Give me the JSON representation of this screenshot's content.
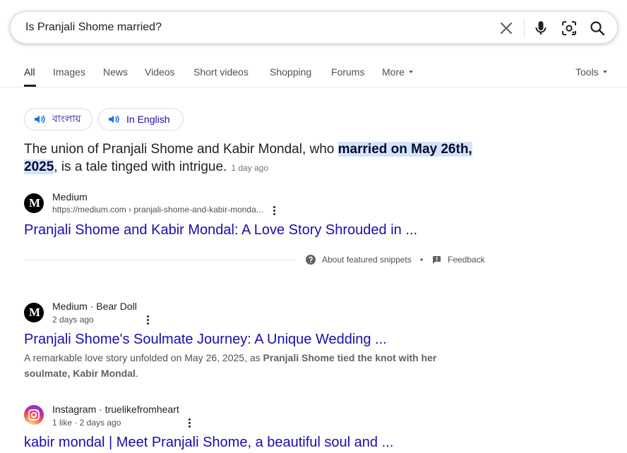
{
  "search": {
    "query": "Is Pranjali Shome married?"
  },
  "tabs": [
    {
      "label": "All"
    },
    {
      "label": "Images"
    },
    {
      "label": "News"
    },
    {
      "label": "Videos"
    },
    {
      "label": "Short videos"
    },
    {
      "label": "Shopping"
    },
    {
      "label": "Forums"
    },
    {
      "label": "More"
    }
  ],
  "tools_label": "Tools",
  "language_pills": {
    "bengali": "বাংলায়",
    "english": "In English"
  },
  "snippet": {
    "text_before": "The union of Pranjali Shome and Kabir Mondal, who ",
    "highlight": "married on May 26th, 2025",
    "text_after": ", is a tale tinged with intrigue.",
    "date": "1 day ago"
  },
  "featured_source": {
    "logo_text": "M",
    "name": "Medium",
    "url": "https://medium.com › pranjali-shome-and-kabir-monda...",
    "title": "Pranjali Shome and Kabir Mondal: A Love Story Shrouded in ..."
  },
  "about": {
    "about_label": "About featured snippets",
    "bullet": "•",
    "feedback_label": "Feedback"
  },
  "results": [
    {
      "logo_text": "M",
      "name": "Medium · Bear Doll",
      "sub": "2 days ago",
      "title": "Pranjali Shome's Soulmate Journey: A Unique Wedding ...",
      "desc_before": "A remarkable love story unfolded on May 26, 2025, as ",
      "desc_bold": "Pranjali Shome tied the knot with her soulmate, Kabir Mondal",
      "desc_after": "."
    },
    {
      "name": "Instagram · truelikefromheart",
      "sub": "1 like · 2 days ago",
      "title": "kabir mondal | Meet Pranjali Shome, a beautiful soul and ..."
    }
  ],
  "colors": {
    "link": "#1a0dab",
    "highlight": "#d3e3fd",
    "text": "#202124",
    "muted": "#4d5156"
  },
  "icons": [
    "close-icon",
    "microphone-icon",
    "lens-icon",
    "search-icon",
    "speaker-icon",
    "question-icon",
    "feedback-icon",
    "more-vert-icon",
    "medium-logo",
    "instagram-logo"
  ]
}
